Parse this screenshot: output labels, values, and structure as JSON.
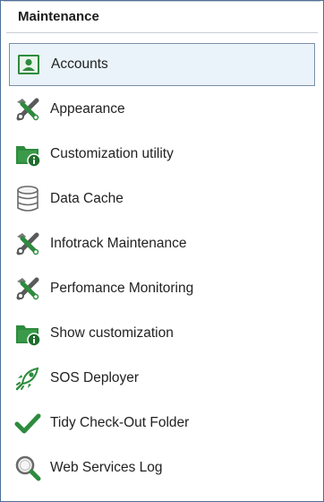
{
  "panel": {
    "title": "Maintenance"
  },
  "items": [
    {
      "label": "Accounts",
      "icon": "accounts-icon",
      "selected": true
    },
    {
      "label": "Appearance",
      "icon": "tools-icon"
    },
    {
      "label": "Customization utility",
      "icon": "folder-info-icon"
    },
    {
      "label": "Data Cache",
      "icon": "database-icon"
    },
    {
      "label": "Infotrack Maintenance",
      "icon": "tools-icon"
    },
    {
      "label": "Perfomance Monitoring",
      "icon": "tools-icon"
    },
    {
      "label": "Show customization",
      "icon": "folder-info-icon"
    },
    {
      "label": "SOS Deployer",
      "icon": "rocket-icon"
    },
    {
      "label": "Tidy Check-Out Folder",
      "icon": "checkmark-icon"
    },
    {
      "label": "Web Services Log",
      "icon": "magnifier-icon"
    }
  ],
  "colors": {
    "accent_green": "#2e8b3e",
    "selection_bg": "#eaf3f9",
    "frame_border": "#4d6f99"
  }
}
